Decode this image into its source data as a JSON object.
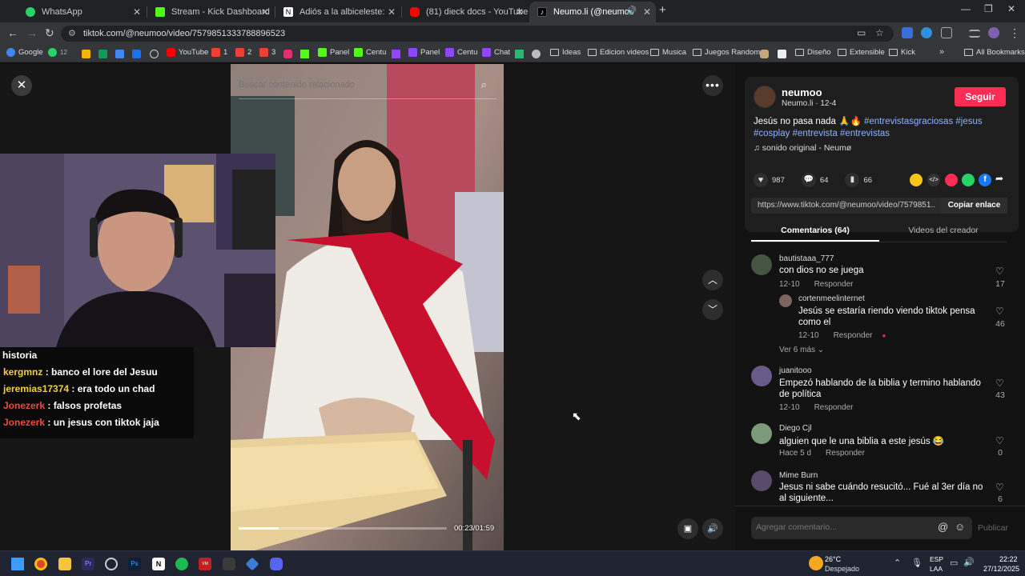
{
  "tabs": [
    {
      "title": "WhatsApp",
      "color": "#25d366"
    },
    {
      "title": "Stream - Kick Dashboard",
      "color": "#53fc18"
    },
    {
      "title": "Adiós a la albiceleste: Obligan a",
      "color": "#ffffff"
    },
    {
      "title": "(81) dieck docs - YouTube",
      "color": "#ff0000"
    },
    {
      "title": "Neumo.li (@neumoo) | TikTo",
      "color": "#000000",
      "active": true
    }
  ],
  "new_tab_label": "+",
  "address": {
    "url": "tiktok.com/@neumoo/video/7579851333788896523"
  },
  "bookmarks": [
    {
      "label": "Google",
      "color": "#4285f4"
    },
    {
      "label": "12",
      "color": "#25d366"
    },
    {
      "label": "YouTube",
      "color": "#ff0000"
    },
    {
      "label": "1",
      "color": "#ea4335"
    },
    {
      "label": "2",
      "color": "#ea4335"
    },
    {
      "label": "3",
      "color": "#ea4335"
    },
    {
      "label": "Panel",
      "color": "#53fc18"
    },
    {
      "label": "Centu",
      "color": "#53fc18"
    },
    {
      "label": "Panel",
      "color": "#9146ff"
    },
    {
      "label": "Centu",
      "color": "#9146ff"
    },
    {
      "label": "Chat",
      "color": "#9146ff"
    },
    {
      "label": "Ideas",
      "folder": true
    },
    {
      "label": "Edicion videos",
      "folder": true
    },
    {
      "label": "Musica",
      "folder": true
    },
    {
      "label": "Juegos Random",
      "folder": true
    },
    {
      "label": "Diseño",
      "folder": true
    },
    {
      "label": "Extensible",
      "folder": true
    },
    {
      "label": "Kick",
      "folder": true
    },
    {
      "label": "All Bookmarks",
      "folder": true
    }
  ],
  "search": {
    "placeholder": "Buscar contenido relacionado"
  },
  "video": {
    "time": "00:23/01:59",
    "progress": 0.193
  },
  "chat": {
    "header": "historia",
    "messages": [
      {
        "user": "kergmnz",
        "text": "banco el lore del Jesuu",
        "color": "#f4d03f"
      },
      {
        "user": "jeremias17374",
        "text": "era todo un chad",
        "color": "#f4d03f"
      },
      {
        "user": "Jonezerk",
        "text": "falsos profetas",
        "color": "#e74c3c"
      },
      {
        "user": "Jonezerk",
        "text": "un jesus con tiktok jaja",
        "color": "#e74c3c"
      }
    ]
  },
  "author": {
    "name": "neumoo",
    "handle": "Neumo.li · 12-4",
    "follow": "Seguir",
    "caption_text": "Jesús no pasa nada 🙏🔥",
    "caption_tags": "#entrevistasgraciosas #jesus #cosplay #entrevista #entrevistas",
    "sound": "sonido original - Neumø"
  },
  "stats": {
    "likes": "987",
    "comments": "64",
    "saves": "66"
  },
  "share": {
    "link": "https://www.tiktok.com/@neumoo/video/7579851...",
    "copy": "Copiar enlace"
  },
  "panel_tabs": {
    "comments": "Comentarios (64)",
    "creator": "Videos del creador"
  },
  "comments": [
    {
      "user": "bautistaaa_777",
      "text": "con dios no se juega",
      "date": "12-10",
      "reply": "Responder",
      "likes": "17",
      "color": "#445544"
    },
    {
      "user": "cortenmeelinternet",
      "text": "Jesús se estaría riendo viendo tiktok pensa como el",
      "date": "12-10",
      "reply": "Responder",
      "likes": "46",
      "color": "#7a6660",
      "nested": true
    },
    {
      "user": "juanitooo",
      "text": "Empezó hablando de la biblia y termino hablando de política",
      "date": "12-10",
      "reply": "Responder",
      "likes": "43",
      "color": "#6a5a8a"
    },
    {
      "user": "Diego Cjl",
      "text": "alguien que le una biblia a este jesús 😂",
      "date": "Hace 5 d",
      "reply": "Responder",
      "likes": "0",
      "color": "#7a9a7a"
    },
    {
      "user": "Mime Burn",
      "text": "Jesus ni sabe cuándo resucitó... Fué al 3er día no al siguiente...",
      "date": "",
      "reply": "",
      "likes": "6",
      "color": "#5a4a6a"
    }
  ],
  "more_replies": "Ver 6 más",
  "add_comment": {
    "placeholder": "Agregar comentario...",
    "post": "Publicar"
  },
  "taskbar": {
    "weather_temp": "26°C",
    "weather_desc": "Despejado",
    "lang": "ESP",
    "lang2": "LAA",
    "time": "22:22",
    "date": "27/12/2025"
  }
}
